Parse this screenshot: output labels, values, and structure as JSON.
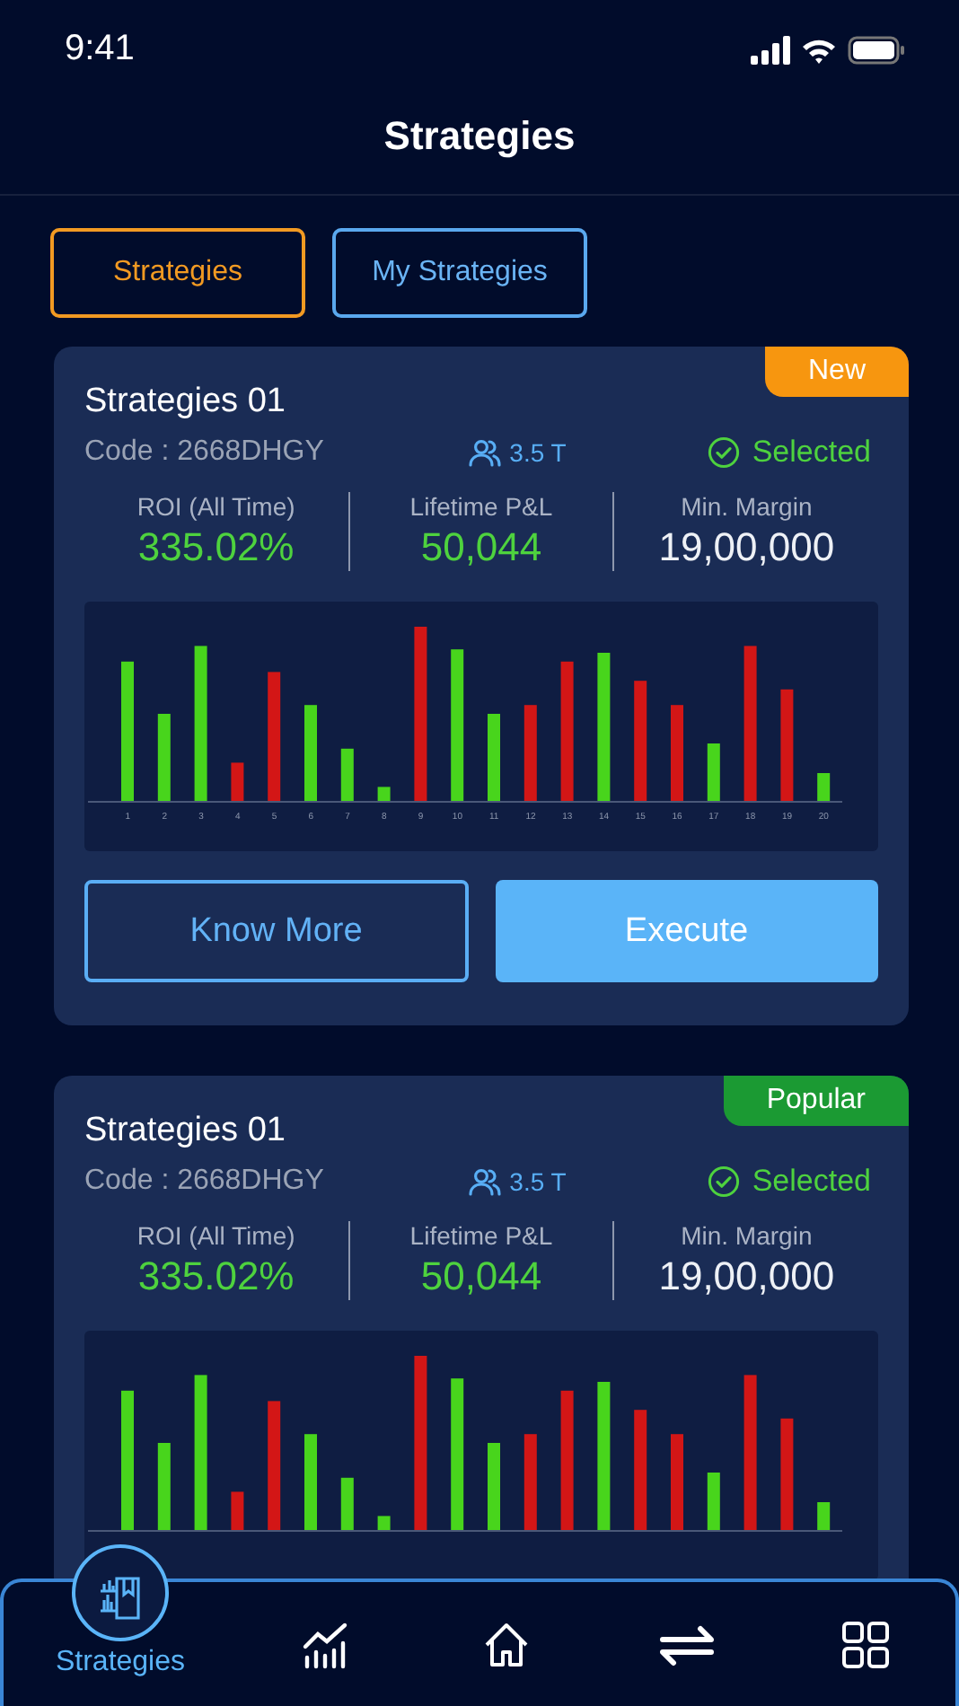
{
  "status_bar": {
    "time": "9:41"
  },
  "header": {
    "title": "Strategies"
  },
  "tabs": [
    {
      "label": "Strategies",
      "selected": true
    },
    {
      "label": "My Strategies",
      "selected": false
    }
  ],
  "strategies": [
    {
      "badge": {
        "label": "New",
        "color": "#f7960f"
      },
      "name": "Strategies 01",
      "code": "Code : 2668DHGY",
      "followers": "3.5 T",
      "status": {
        "label": "Selected",
        "selected": true
      },
      "stats": [
        {
          "label": "ROI (All Time)",
          "value": "335.02%",
          "kind": "gain"
        },
        {
          "label": "Lifetime P&L",
          "value": "50,044",
          "kind": "gain"
        },
        {
          "label": "Min. Margin",
          "value": "19,00,000",
          "kind": "plain"
        }
      ],
      "chart": {
        "x_labels": [
          "1",
          "2",
          "3",
          "4",
          "5",
          "6",
          "7",
          "8",
          "9",
          "10",
          "11",
          "12",
          "13",
          "14",
          "15",
          "16",
          "17",
          "18",
          "19",
          "20"
        ]
      },
      "buttons": [
        {
          "label": "Know More",
          "kind": "outline"
        },
        {
          "label": "Execute",
          "kind": "filled"
        }
      ]
    },
    {
      "badge": {
        "label": "Popular",
        "color": "#1b9a33"
      },
      "name": "Strategies 01",
      "code": "Code : 2668DHGY",
      "followers": "3.5 T",
      "status": {
        "label": "Selected",
        "selected": true
      },
      "stats": [
        {
          "label": "ROI (All Time)",
          "value": "335.02%",
          "kind": "gain"
        },
        {
          "label": "Lifetime P&L",
          "value": "50,044",
          "kind": "gain"
        },
        {
          "label": "Min. Margin",
          "value": "19,00,000",
          "kind": "plain"
        }
      ]
    }
  ],
  "bottom_nav": [
    {
      "kind": "strategies",
      "label": "Strategies",
      "selected": true
    },
    {
      "kind": "analytics",
      "selected": false
    },
    {
      "kind": "home",
      "selected": false
    },
    {
      "kind": "transfer",
      "selected": false
    },
    {
      "kind": "apps",
      "selected": false
    }
  ]
}
